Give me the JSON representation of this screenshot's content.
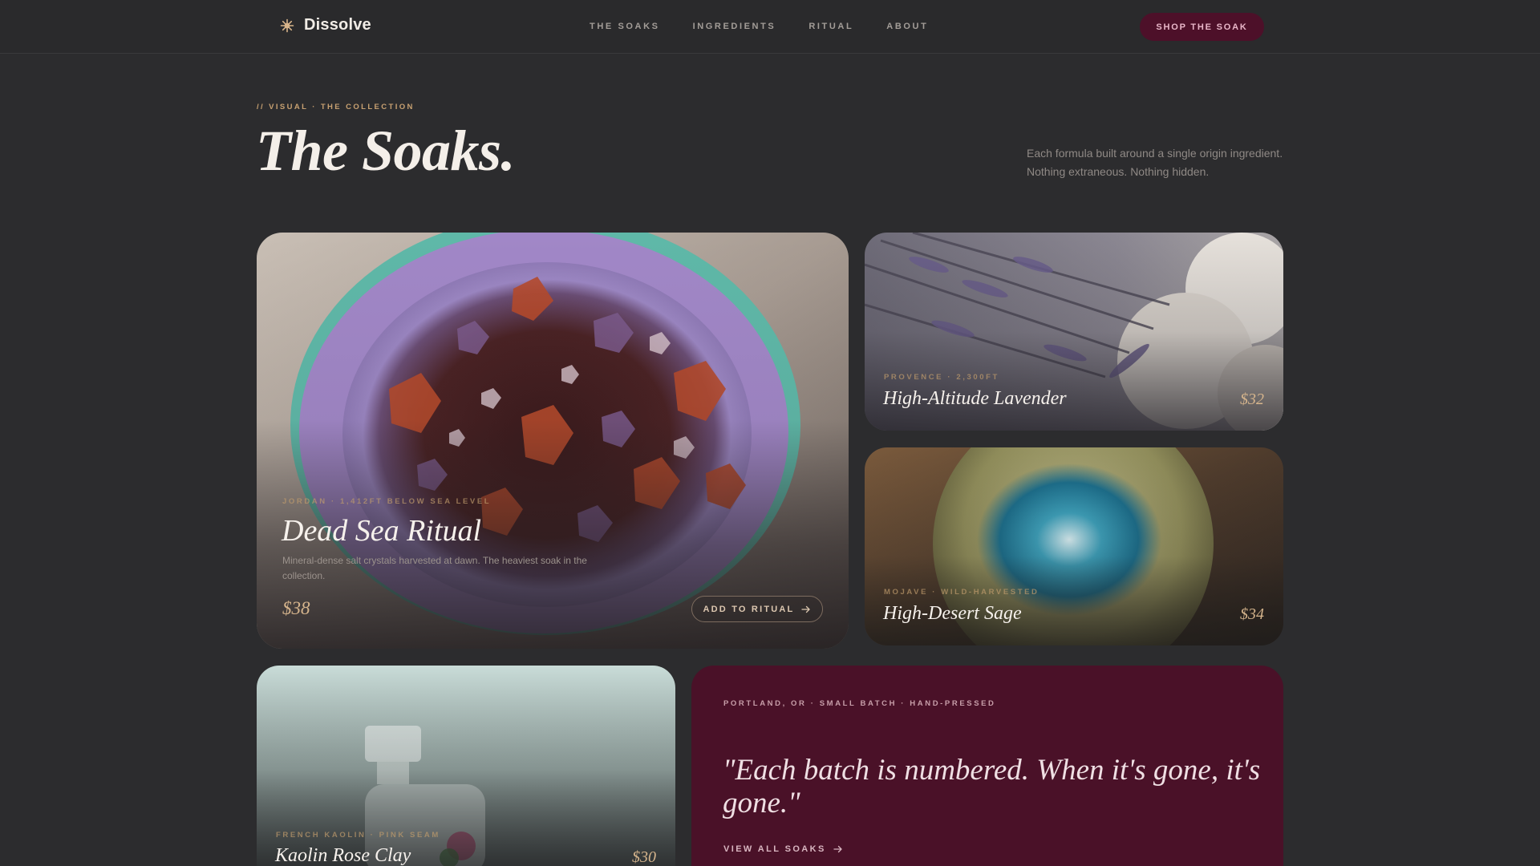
{
  "brand": {
    "name": "Dissolve",
    "icon": "sun-icon",
    "accent": "#c8a171"
  },
  "nav": {
    "links": [
      "THE SOAKS",
      "INGREDIENTS",
      "RITUAL",
      "ABOUT"
    ],
    "cta": "SHOP THE SOAK",
    "cta_color": "#4d1029"
  },
  "header": {
    "eyebrow": "// VISUAL · THE COLLECTION",
    "title": "The Soaks.",
    "intro_line1": "Each formula built around a single origin ingredient.",
    "intro_line2": "Nothing extraneous. Nothing hidden."
  },
  "products": {
    "dead_sea": {
      "meta": "JORDAN · 1,412FT BELOW SEA LEVEL",
      "name": "Dead Sea Ritual",
      "desc": "Mineral-dense salt crystals harvested at dawn. The heaviest soak in the collection.",
      "price": "$38",
      "button": "ADD TO RITUAL"
    },
    "lavender": {
      "meta": "PROVENCE · 2,300FT",
      "name": "High-Altitude Lavender",
      "price": "$32"
    },
    "sage": {
      "meta": "MOJAVE · WILD-HARVESTED",
      "name": "High-Desert Sage",
      "price": "$34"
    },
    "kaolin": {
      "meta": "FRENCH KAOLIN · PINK SEAM",
      "name": "Kaolin Rose Clay",
      "price": "$30"
    }
  },
  "quote_card": {
    "meta": "PORTLAND, OR · SMALL BATCH · HAND-PRESSED",
    "quote": "\"Each batch is numbered. When it's gone, it's gone.\"",
    "link": "VIEW ALL SOAKS",
    "background": "#4a1128"
  }
}
